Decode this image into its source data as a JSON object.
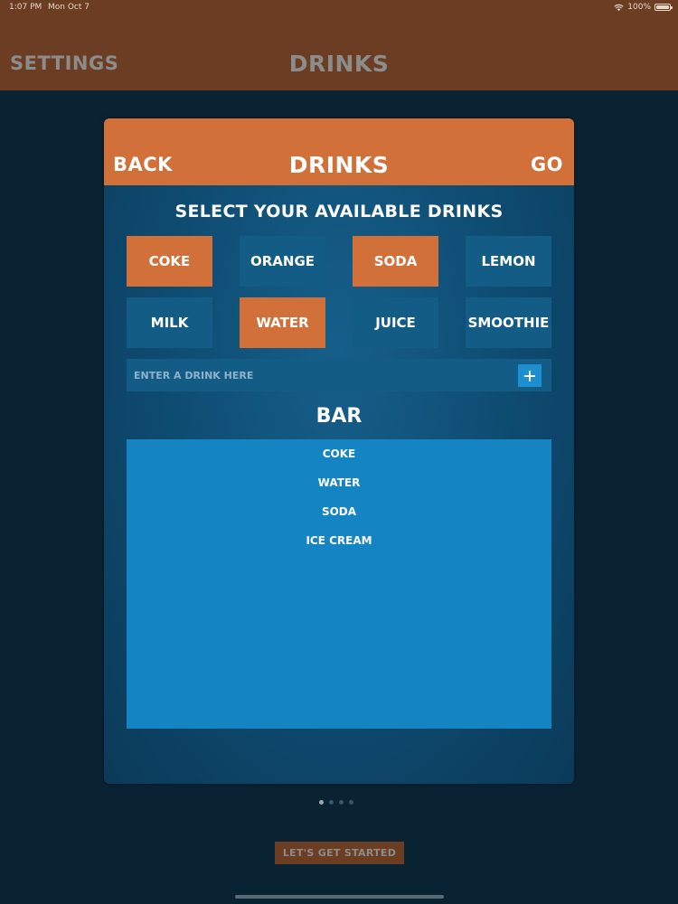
{
  "status_bar": {
    "time": "1:07 PM",
    "date": "Mon Oct 7",
    "battery": "100%"
  },
  "top_nav": {
    "settings_label": "SETTINGS",
    "title": "DRINKS"
  },
  "card": {
    "back_label": "BACK",
    "title": "DRINKS",
    "go_label": "GO",
    "section_heading": "SELECT YOUR AVAILABLE DRINKS",
    "drinks": [
      {
        "label": "COKE",
        "selected": true
      },
      {
        "label": "ORANGE",
        "selected": false
      },
      {
        "label": "SODA",
        "selected": true
      },
      {
        "label": "LEMON",
        "selected": false
      },
      {
        "label": "MILK",
        "selected": false
      },
      {
        "label": "WATER",
        "selected": true
      },
      {
        "label": "JUICE",
        "selected": false
      },
      {
        "label": "SMOOTHIE",
        "selected": false
      }
    ],
    "add_input": {
      "placeholder": "ENTER A DRINK HERE",
      "value": ""
    },
    "add_button_icon": "plus-icon",
    "bar_heading": "BAR",
    "bar_items": [
      "COKE",
      "WATER",
      "SODA",
      "ICE CREAM"
    ]
  },
  "pagination": {
    "total_pages": 4,
    "current_page": 1
  },
  "start_button_label": "LET'S GET STARTED",
  "colors": {
    "accent_orange": "#d2703a",
    "nav_brown": "#6b3d23",
    "background_navy": "#0a2333",
    "button_blue": "#135c86",
    "list_blue": "#1584c3"
  }
}
